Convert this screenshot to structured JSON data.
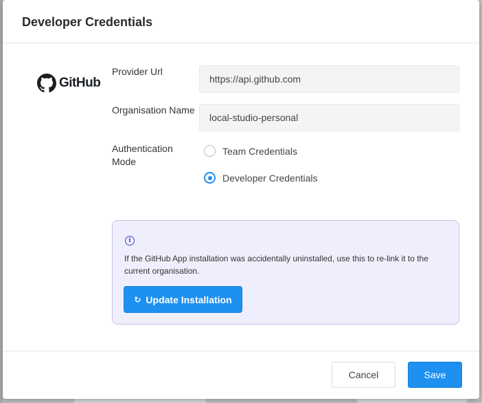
{
  "dialog": {
    "title": "Developer Credentials"
  },
  "provider": {
    "name": "GitHub",
    "icon": "github-octocat-icon"
  },
  "form": {
    "provider_url_label": "Provider Url",
    "provider_url_value": "https://api.github.com",
    "organisation_name_label": "Organisation Name",
    "organisation_name_value": "local-studio-personal",
    "auth_mode_label": "Authentication Mode",
    "auth_options": [
      {
        "label": "Team Credentials",
        "selected": false
      },
      {
        "label": "Developer Credentials",
        "selected": true
      }
    ]
  },
  "info": {
    "icon": "info-icon",
    "text": "If the GitHub App installation was accidentally uninstalled, use this to re-link it to the current organisation.",
    "button_label": "Update Installation",
    "button_icon": "refresh-icon"
  },
  "footer": {
    "cancel_label": "Cancel",
    "save_label": "Save"
  },
  "colors": {
    "accent": "#1e90f0",
    "info_background": "#efeefc",
    "info_border": "#c7c4e6",
    "info_icon": "#4c46c8"
  }
}
